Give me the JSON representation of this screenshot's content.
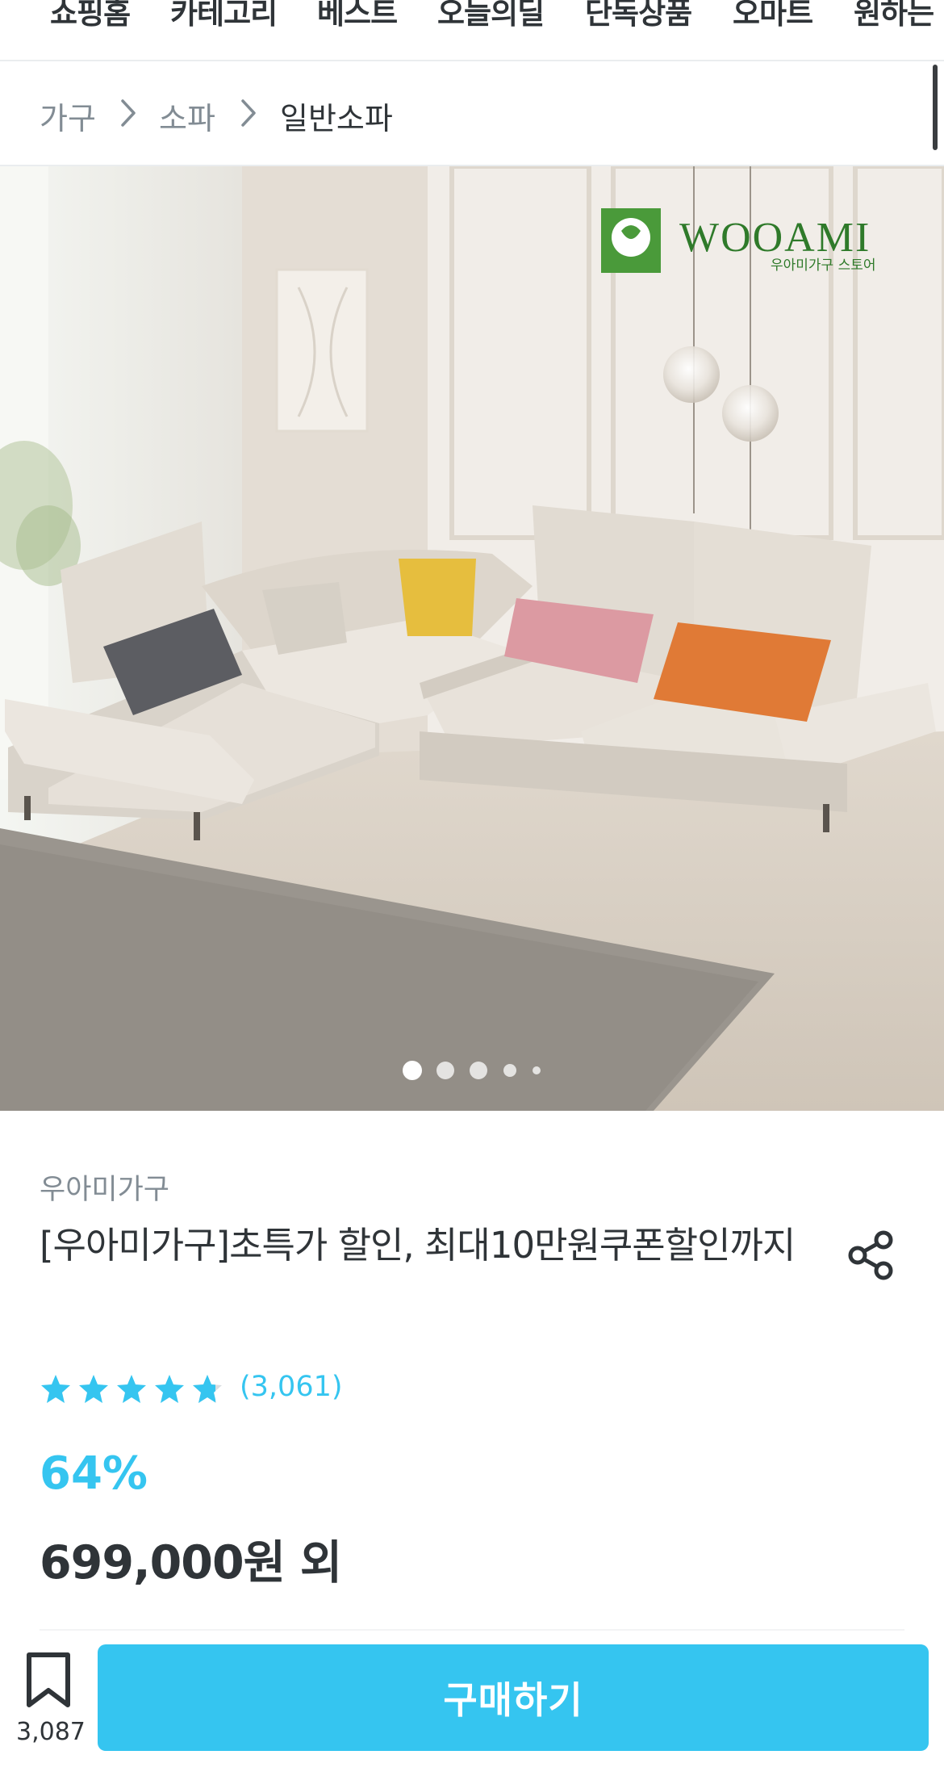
{
  "top_nav": {
    "tabs": [
      "쇼핑홈",
      "카테고리",
      "베스트",
      "오늘의딜",
      "단독상품",
      "오마트",
      "원하는"
    ]
  },
  "breadcrumb": {
    "items": [
      "가구",
      "소파",
      "일반소파"
    ]
  },
  "hero": {
    "logo_text": "WOOAMI",
    "logo_subtext": "우아미가구 스토어",
    "image_count": 5,
    "active_index": 0
  },
  "product": {
    "brand": "우아미가구",
    "title": "[우아미가구]초특가 할인, 최대10만원쿠폰할인까지",
    "rating": 4.7,
    "review_count": "(3,061)",
    "discount": "64%",
    "price": "699,000원 외"
  },
  "bottom_bar": {
    "bookmark_count": "3,087",
    "buy_label": "구매하기"
  },
  "colors": {
    "accent": "#35c5f0",
    "text": "#2f3438",
    "muted": "#828c94"
  }
}
